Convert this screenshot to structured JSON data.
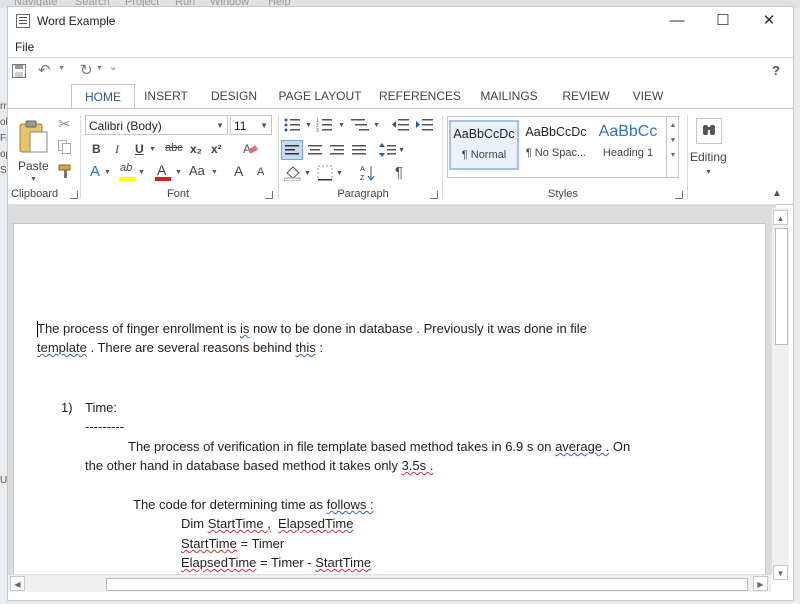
{
  "background": {
    "top_menu": [
      "Navigate",
      "Search",
      "Project",
      "Run",
      "Window",
      "Help"
    ],
    "left_fragments": [
      "rr",
      "ole",
      "Fre",
      "op",
      "Si",
      "Ui",
      "1"
    ]
  },
  "window": {
    "title": "Word Example",
    "controls": {
      "minimize": "—",
      "maximize": "☐",
      "close": "✕"
    }
  },
  "menu": {
    "file": "File"
  },
  "qat": {
    "save_icon": "save-icon",
    "undo_icon": "undo-icon",
    "redo_icon": "redo-icon",
    "help": "?"
  },
  "tabs": [
    {
      "label": "HOME",
      "active": true
    },
    {
      "label": "INSERT"
    },
    {
      "label": "DESIGN"
    },
    {
      "label": "PAGE LAYOUT"
    },
    {
      "label": "REFERENCES"
    },
    {
      "label": "MAILINGS"
    },
    {
      "label": "REVIEW"
    },
    {
      "label": "VIEW"
    }
  ],
  "ribbon": {
    "clipboard": {
      "label": "Clipboard",
      "paste": "Paste"
    },
    "font": {
      "label": "Font",
      "family": "Calibri (Body)",
      "size": "11",
      "bold": "B",
      "italic": "I",
      "underline": "U",
      "strike": "abc",
      "subscript": "x₂",
      "superscript": "x²",
      "text_effects": "A",
      "highlight": "ab",
      "font_color": "A",
      "change_case": "Aa",
      "grow": "A",
      "shrink": "A"
    },
    "paragraph": {
      "label": "Paragraph",
      "show_marks": "¶"
    },
    "styles": {
      "label": "Styles",
      "items": [
        {
          "sample": "AaBbCcDc",
          "name": "¶ Normal"
        },
        {
          "sample": "AaBbCcDc",
          "name": "¶ No Spac..."
        },
        {
          "sample": "AaBbCc",
          "name": "Heading 1"
        }
      ]
    },
    "editing": {
      "label": "Editing"
    }
  },
  "document": {
    "para1_a": "The process of finger enrollment is ",
    "para1_is": "is",
    "para1_b": " now to be done in database . Previously it was done in file",
    "para1_line2_a": "template",
    "para1_line2_b": " . There are several reasons behind ",
    "para1_line2_this": "this",
    "para1_line2_c": " :",
    "list_num": "1)",
    "list_title": "Time:",
    "dashes": "---------",
    "p2_a": "The process of verification in file template based method takes in 6.9 s on ",
    "p2_avg": "average .",
    "p2_b": " On",
    "p3_a": "the other hand in database based method it takes only ",
    "p3_35": "3.5s .",
    "p4_a": "The code for determining time as ",
    "p4_follows": "follows :",
    "code1_a": "Dim ",
    "code1_st": "StartTime ,",
    "code1_b": "  ",
    "code1_el": "ElapsedTime",
    "code2_st": "StartTime",
    "code2_b": " = Timer",
    "code3_el": "ElapsedTime",
    "code3_b": " = Timer - ",
    "code3_st": "StartTime"
  }
}
